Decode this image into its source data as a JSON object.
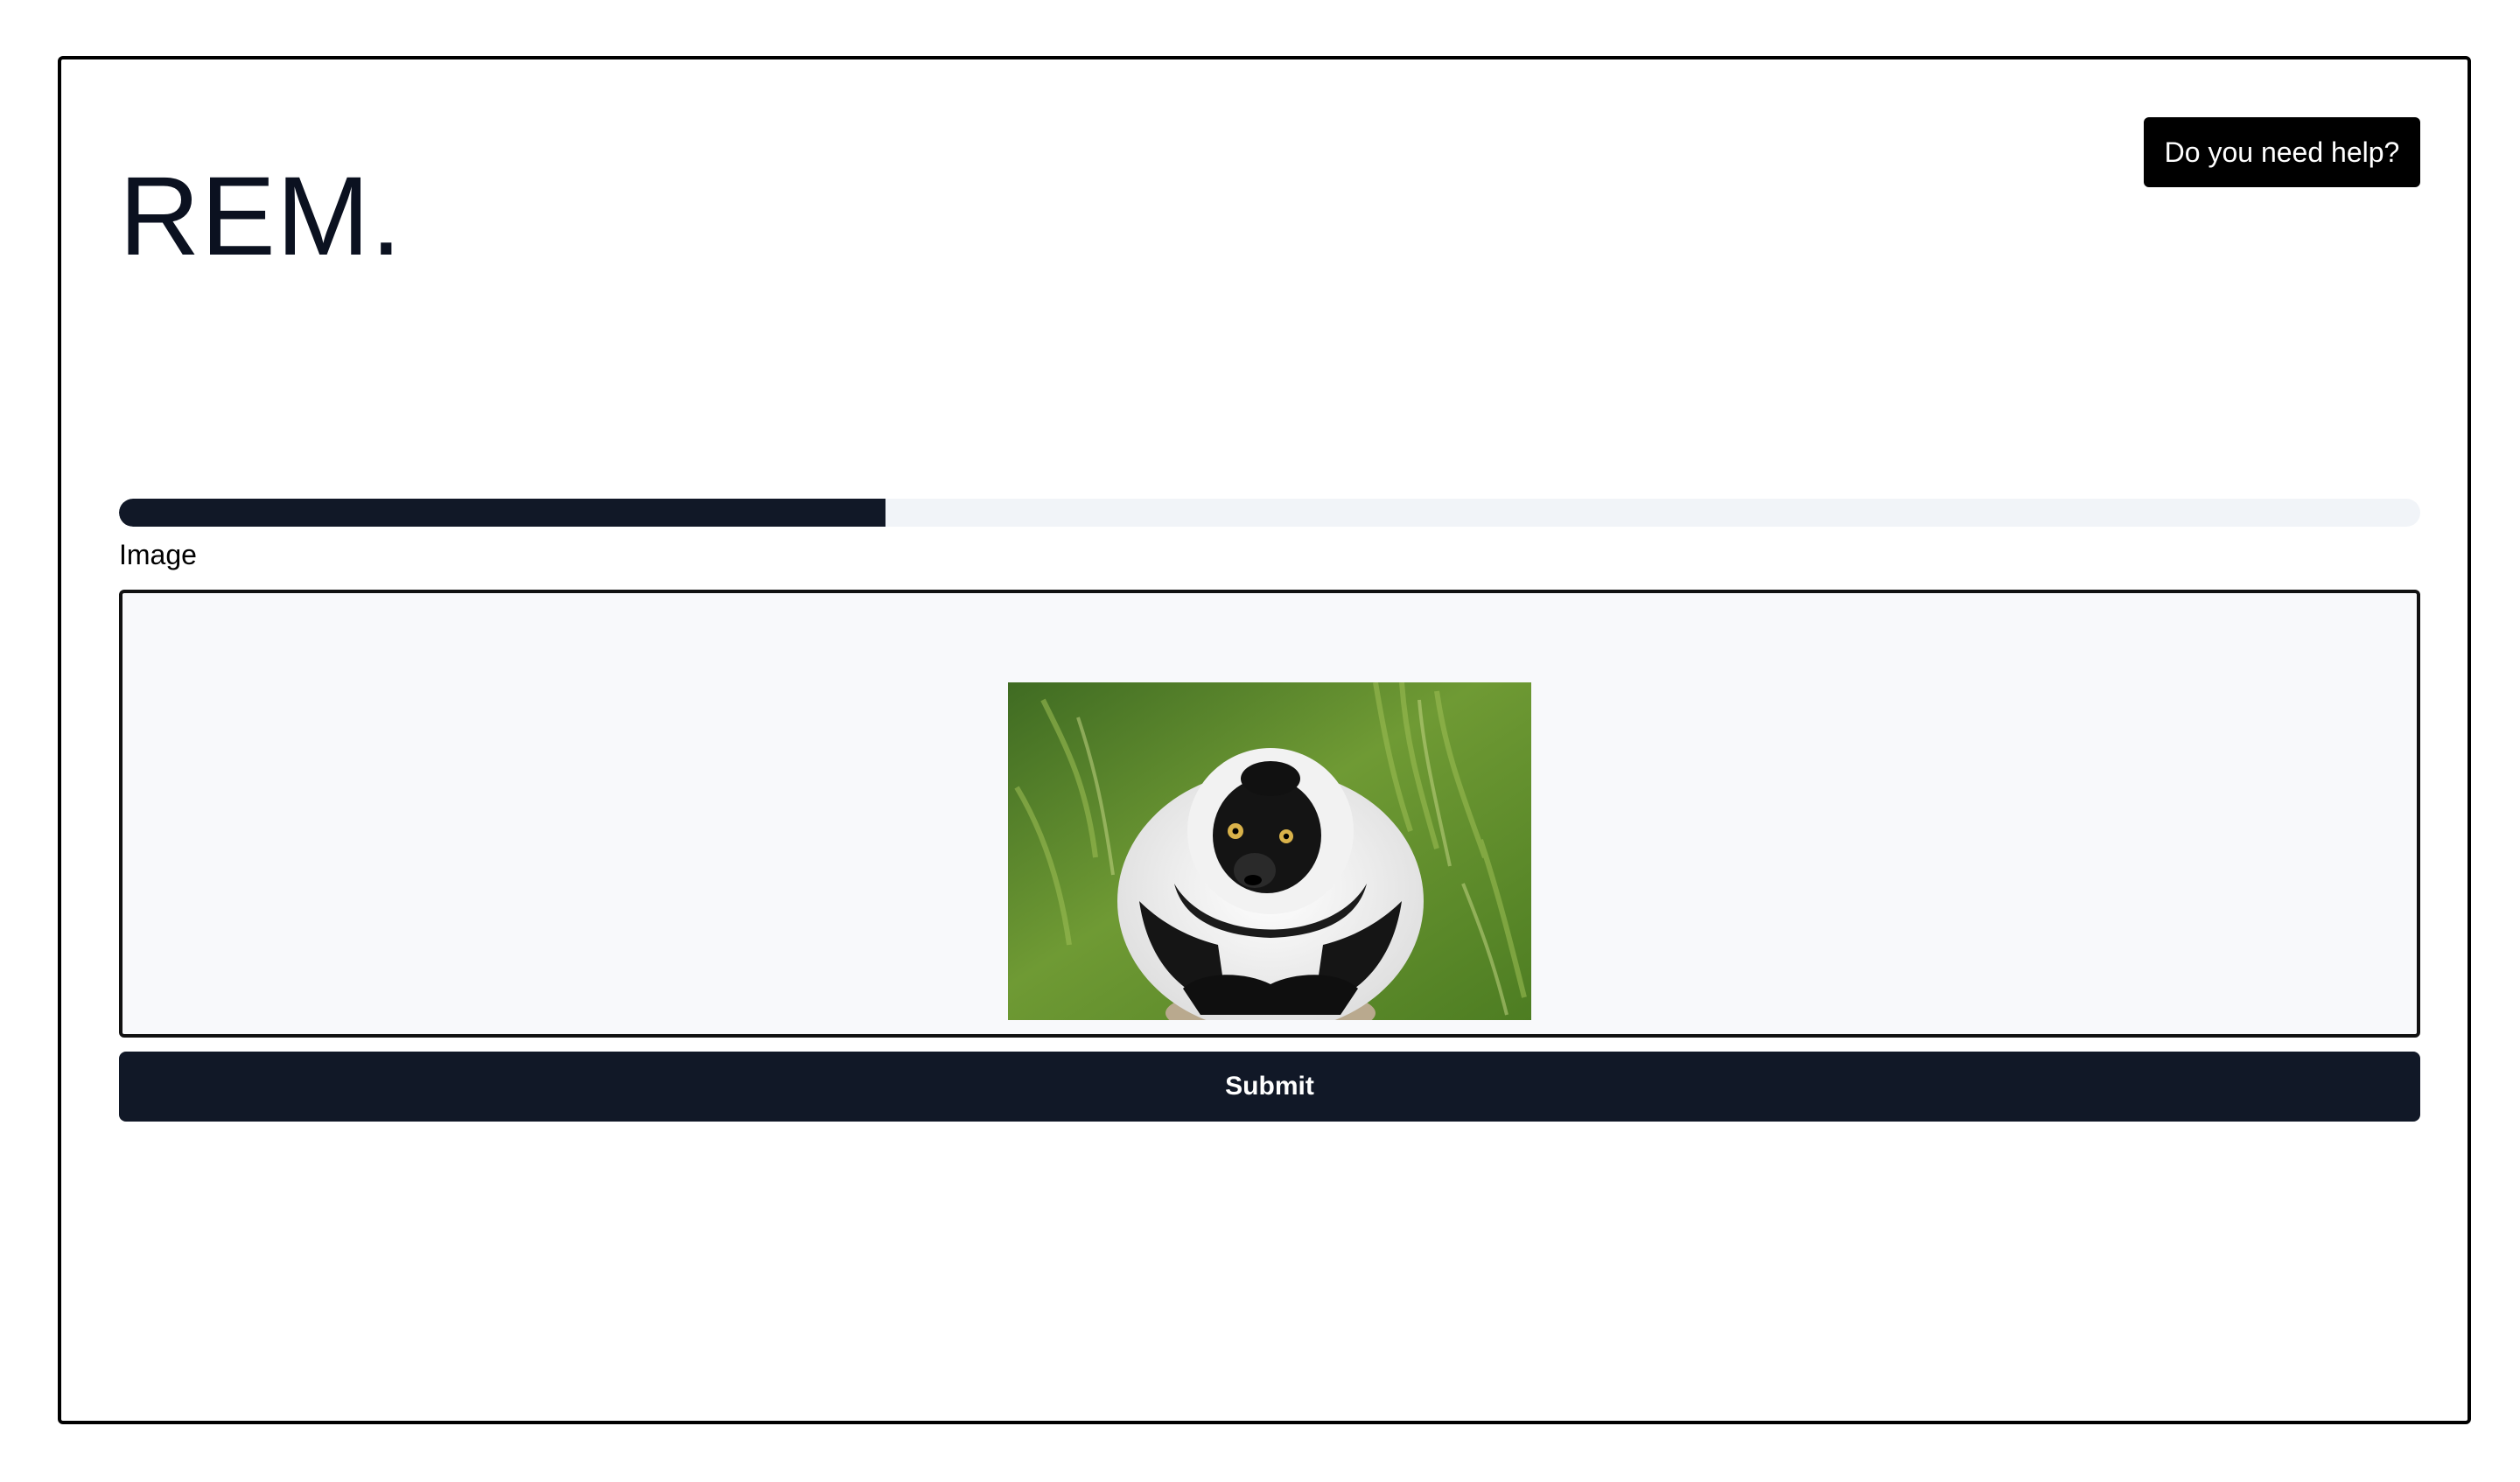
{
  "header": {
    "logo": "REM.",
    "help_label": "Do you need help?"
  },
  "progress": {
    "percent": 33.3
  },
  "form": {
    "image_label": "Image",
    "submit_label": "Submit"
  },
  "colors": {
    "primary": "#111827",
    "progress_track": "#f1f4f8",
    "dropzone_bg": "#f8f9fb"
  },
  "icons": {
    "preview": "lemur-photo"
  }
}
